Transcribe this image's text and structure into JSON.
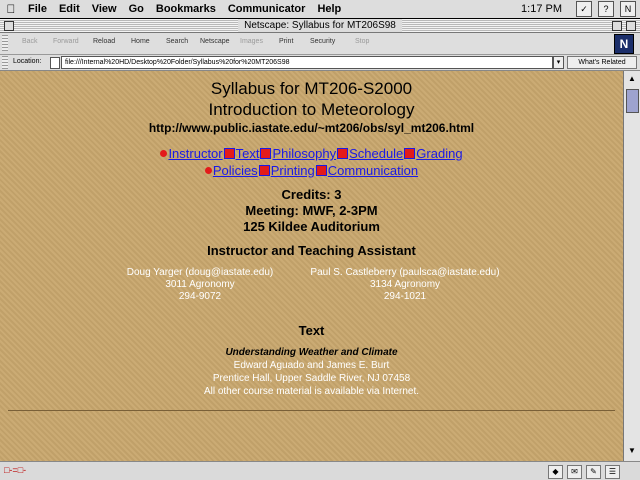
{
  "menubar": {
    "items": [
      "File",
      "Edit",
      "View",
      "Go",
      "Bookmarks",
      "Communicator",
      "Help"
    ],
    "clock": "1:17 PM"
  },
  "window": {
    "title": "Netscape: Syllabus for MT206S98"
  },
  "toolbar": {
    "buttons": [
      "Back",
      "Forward",
      "Reload",
      "Home",
      "Search",
      "Netscape",
      "Images",
      "Print",
      "Security",
      "Stop"
    ],
    "logo": "N"
  },
  "location": {
    "label": "Location:",
    "url": "file:///Internal%20HD/Desktop%20Folder/Syllabus%20for%20MT206S98",
    "related": "What's Related"
  },
  "page": {
    "title": "Syllabus for MT206-S2000",
    "subtitle": "Introduction to Meteorology",
    "url": "http://www.public.iastate.edu/~mt206/obs/syl_mt206.html",
    "nav_row1": [
      "Instructor",
      "Text",
      "Philosophy",
      "Schedule",
      "Grading"
    ],
    "nav_row2": [
      "Policies",
      "Printing",
      "Communication"
    ],
    "credits": "Credits: 3",
    "meeting": "Meeting: MWF, 2-3PM",
    "location": "125 Kildee Auditorium",
    "instructor_heading": "Instructor and Teaching Assistant",
    "instructor": {
      "name": "Doug Yarger (doug@iastate.edu)",
      "office": "3011 Agronomy",
      "phone": "294-9072"
    },
    "ta": {
      "name": "Paul S. Castleberry (paulsca@iastate.edu)",
      "office": "3134 Agronomy",
      "phone": "294-1021"
    },
    "text_heading": "Text",
    "book_title": "Understanding Weather and Climate",
    "book_authors": "Edward Aguado and James E. Burt",
    "book_publisher": "Prentice Hall, Upper Saddle River, NJ 07458",
    "book_note": "All other course material is available via Internet."
  },
  "colors": {
    "page_background": "#c8a76d",
    "link": "#1a1ae6",
    "bullet": "#e31b1b"
  }
}
